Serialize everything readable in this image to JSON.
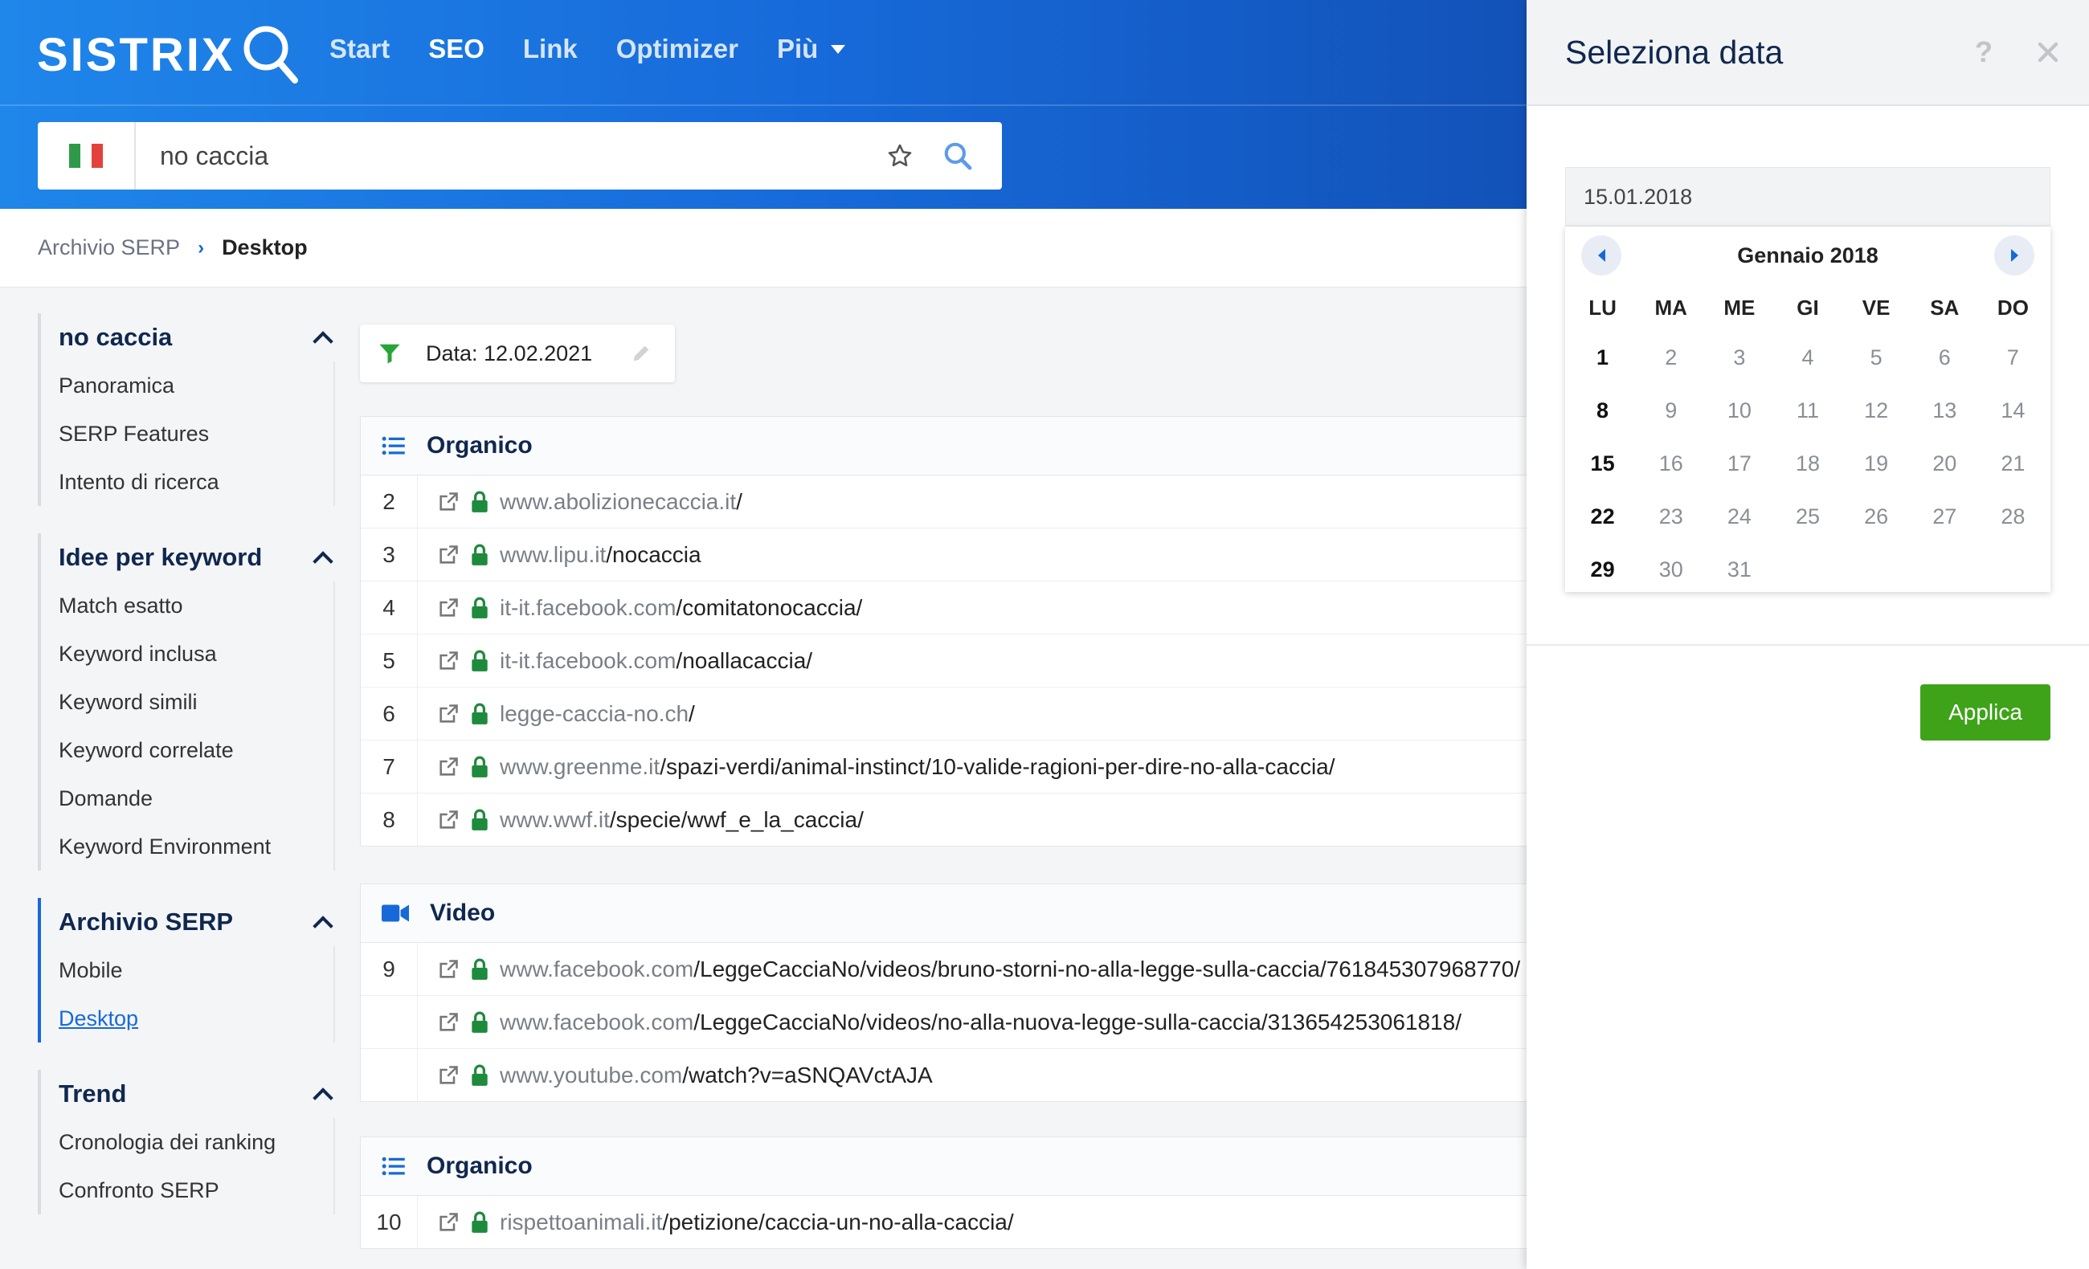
{
  "header": {
    "logo_text": "SISTRIX",
    "nav": [
      {
        "label": "Start"
      },
      {
        "label": "SEO"
      },
      {
        "label": "Link"
      },
      {
        "label": "Optimizer"
      },
      {
        "label": "Più"
      }
    ],
    "search": {
      "value": "no caccia",
      "country_flag": "italy-flag"
    }
  },
  "breadcrumb": {
    "parent": "Archivio SERP",
    "separator": "›",
    "current": "Desktop"
  },
  "sidebar": {
    "groups": [
      {
        "title": "no caccia",
        "items": [
          "Panoramica",
          "SERP Features",
          "Intento di ricerca"
        ]
      },
      {
        "title": "Idee per keyword",
        "items": [
          "Match esatto",
          "Keyword inclusa",
          "Keyword simili",
          "Keyword correlate",
          "Domande",
          "Keyword Environment"
        ]
      },
      {
        "title": "Archivio SERP",
        "items": [
          "Mobile",
          "Desktop"
        ],
        "active_item": "Desktop"
      },
      {
        "title": "Trend",
        "items": [
          "Cronologia dei ranking",
          "Confronto SERP"
        ]
      }
    ]
  },
  "filter": {
    "label": "Data: 12.02.2021"
  },
  "panels": [
    {
      "title": "Organico",
      "icon": "list-icon",
      "rows": [
        {
          "rank": "2",
          "domain": "www.abolizionecaccia.it",
          "path": "/"
        },
        {
          "rank": "3",
          "domain": "www.lipu.it",
          "path": "/nocaccia"
        },
        {
          "rank": "4",
          "domain": "it-it.facebook.com",
          "path": "/comitatonocaccia/"
        },
        {
          "rank": "5",
          "domain": "it-it.facebook.com",
          "path": "/noallacaccia/"
        },
        {
          "rank": "6",
          "domain": "legge-caccia-no.ch",
          "path": "/"
        },
        {
          "rank": "7",
          "domain": "www.greenme.it",
          "path": "/spazi-verdi/animal-instinct/10-valide-ragioni-per-dire-no-alla-caccia/"
        },
        {
          "rank": "8",
          "domain": "www.wwf.it",
          "path": "/specie/wwf_e_la_caccia/"
        }
      ]
    },
    {
      "title": "Video",
      "icon": "video-icon",
      "rows": [
        {
          "rank": "9",
          "domain": "www.facebook.com",
          "path": "/LeggeCacciaNo/videos/bruno-storni-no-alla-legge-sulla-caccia/761845307968770/"
        },
        {
          "rank": "",
          "domain": "www.facebook.com",
          "path": "/LeggeCacciaNo/videos/no-alla-nuova-legge-sulla-caccia/313654253061818/"
        },
        {
          "rank": "",
          "domain": "www.youtube.com",
          "path": "/watch?v=aSNQAVctAJA"
        }
      ]
    },
    {
      "title": "Organico",
      "icon": "list-icon",
      "rows": [
        {
          "rank": "10",
          "domain": "rispettoanimali.it",
          "path": "/petizione/caccia-un-no-alla-caccia/"
        }
      ]
    }
  ],
  "date_panel": {
    "title": "Seleziona data",
    "help": "?",
    "date_value": "15.01.2018",
    "month_label": "Gennaio 2018",
    "weekdays": [
      "LU",
      "MA",
      "ME",
      "GI",
      "VE",
      "SA",
      "DO"
    ],
    "weeks": [
      [
        "1",
        "2",
        "3",
        "4",
        "5",
        "6",
        "7"
      ],
      [
        "8",
        "9",
        "10",
        "11",
        "12",
        "13",
        "14"
      ],
      [
        "15",
        "16",
        "17",
        "18",
        "19",
        "20",
        "21"
      ],
      [
        "22",
        "23",
        "24",
        "25",
        "26",
        "27",
        "28"
      ],
      [
        "29",
        "30",
        "31",
        "",
        "",
        "",
        ""
      ]
    ],
    "bold_days": [
      "1",
      "8",
      "15",
      "22",
      "29"
    ],
    "apply_label": "Applica"
  },
  "colors": {
    "brand_blue": "#1769d9",
    "lock_green": "#1e8a3c",
    "apply_green": "#3fa31a",
    "filter_green": "#27a539"
  }
}
